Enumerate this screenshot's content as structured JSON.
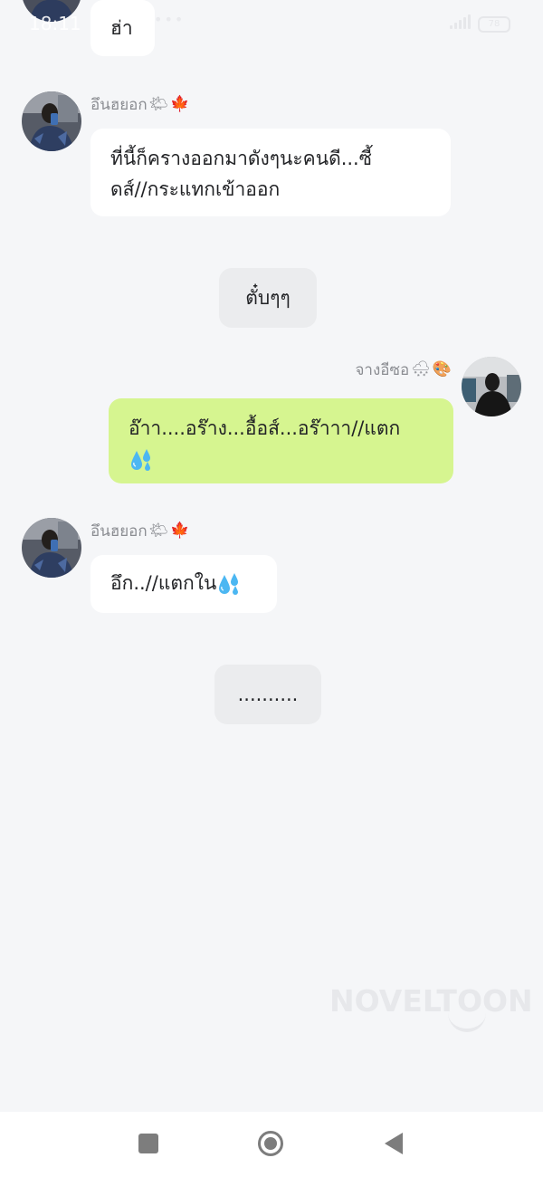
{
  "status_bar": {
    "time": "18:11",
    "more_dots": "•••",
    "battery": "78"
  },
  "messages": [
    {
      "id": "m0",
      "side": "left",
      "text": "ฮ่า"
    },
    {
      "id": "m1",
      "side": "left",
      "sender": "อึนฮยอก",
      "sender_emojis": [
        "🌤",
        "🍁"
      ],
      "lines": [
        "ที่นี้ก็ครางออกมาดังๆนะคนดี...ซี้",
        "ดส์//กระแทกเข้าออก"
      ]
    },
    {
      "id": "m2",
      "side": "center",
      "text": "ตั๋บๆๆ"
    },
    {
      "id": "m3",
      "side": "right",
      "sender": "จางอีซอ",
      "sender_emojis": [
        "🌨",
        "🎨"
      ],
      "lines": [
        "อ๊าา....อร๊าง...อื้อส์...อร๊าาา//แตก",
        ""
      ],
      "trailing_emoji": "sweat-droplets"
    },
    {
      "id": "m4",
      "side": "left",
      "sender": "อึนฮยอก",
      "sender_emojis": [
        "🌤",
        "🍁"
      ],
      "text": "อึก..//แตกใน",
      "trailing_emoji": "sweat-droplets"
    },
    {
      "id": "m5",
      "side": "center",
      "text": ".........."
    }
  ],
  "watermark": "NOVELTOON",
  "colors": {
    "background": "#f5f6f8",
    "bubble_left": "#ffffff",
    "bubble_right": "#d6f590",
    "bubble_center": "#ebecee",
    "sender_name": "#8b8d92",
    "sweat_drop": "#4cb7f2"
  },
  "icons": [
    "recents-square-icon",
    "home-circle-icon",
    "back-triangle-icon"
  ]
}
